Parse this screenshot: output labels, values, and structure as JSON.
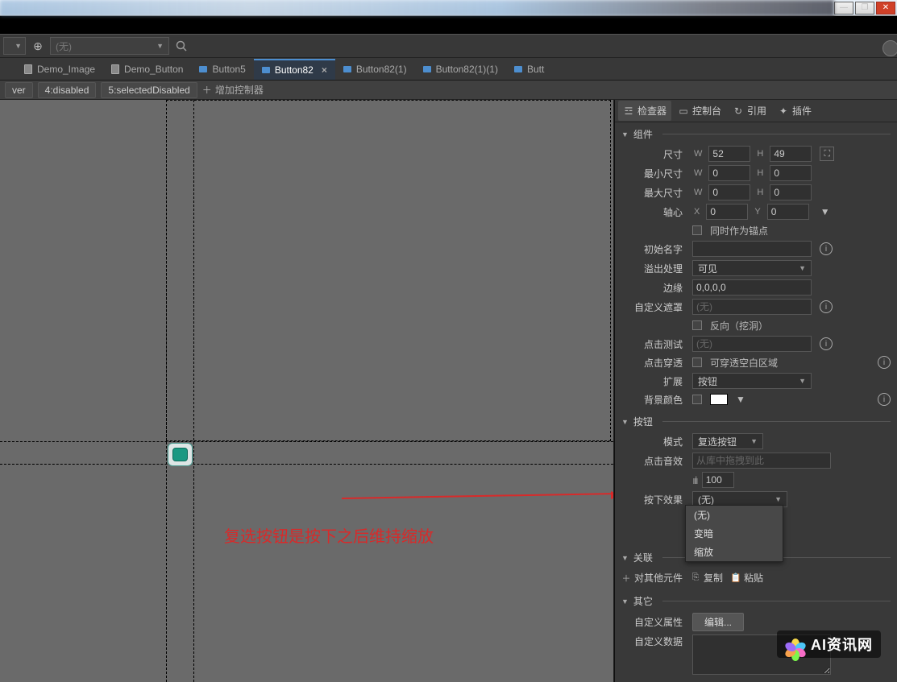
{
  "titlebar": {
    "minimize": "—",
    "maximize": "❐",
    "close": "✕"
  },
  "toolbar": {
    "none_label": "(无)",
    "search_icon": "search"
  },
  "tabs": [
    {
      "label": "Demo_Image",
      "type": "doc"
    },
    {
      "label": "Demo_Button",
      "type": "doc"
    },
    {
      "label": "Button5",
      "type": "comp"
    },
    {
      "label": "Button82",
      "type": "comp",
      "active": true,
      "closable": true
    },
    {
      "label": "Button82(1)",
      "type": "comp"
    },
    {
      "label": "Button82(1)(1)",
      "type": "comp"
    },
    {
      "label": "Butt",
      "type": "comp"
    }
  ],
  "states": [
    {
      "label": "ver"
    },
    {
      "label": "4:disabled"
    },
    {
      "label": "5:selectedDisabled"
    }
  ],
  "add_controller": "增加控制器",
  "insp_tabs": [
    {
      "label": "检查器",
      "icon": "☰",
      "active": true
    },
    {
      "label": "控制台",
      "icon": "▭"
    },
    {
      "label": "引用",
      "icon": "↻"
    },
    {
      "label": "插件",
      "icon": "✦"
    }
  ],
  "sections": {
    "component": "组件",
    "button": "按钮",
    "relation": "关联",
    "other": "其它"
  },
  "props": {
    "size_label": "尺寸",
    "size_w": "52",
    "size_h": "49",
    "min_size_label": "最小尺寸",
    "min_w": "0",
    "min_h": "0",
    "max_size_label": "最大尺寸",
    "max_w": "0",
    "max_h": "0",
    "pivot_label": "轴心",
    "pivot_x": "0",
    "pivot_y": "0",
    "anchor_label": "同时作为锚点",
    "init_name_label": "初始名字",
    "init_name": "",
    "overflow_label": "溢出处理",
    "overflow_val": "可见",
    "margin_label": "边缘",
    "margin_val": "0,0,0,0",
    "mask_label": "自定义遮罩",
    "mask_val": "(无)",
    "reverse_label": "反向（挖洞）",
    "hittest_label": "点击测试",
    "hittest_val": "(无)",
    "through_label": "点击穿透",
    "through_val": "可穿透空白区域",
    "extend_label": "扩展",
    "extend_val": "按钮",
    "bgcolor_label": "背景颜色",
    "mode_label": "模式",
    "mode_val": "复选按钮",
    "sound_label": "点击音效",
    "sound_val": "从库中拖拽到此",
    "volume_val": "100",
    "press_label": "按下效果",
    "press_val": "(无)",
    "rel_other": "对其他元件",
    "copy": "复制",
    "paste": "粘贴",
    "cust_prop_label": "自定义属性",
    "edit_btn": "编辑...",
    "cust_data_label": "自定义数据"
  },
  "dropdown_options": [
    "(无)",
    "变暗",
    "缩放"
  ],
  "annotation": "复选按钮是按下之后维持缩放",
  "logo_text": "AI资讯网",
  "wh": {
    "W": "W",
    "H": "H",
    "X": "X",
    "Y": "Y"
  }
}
